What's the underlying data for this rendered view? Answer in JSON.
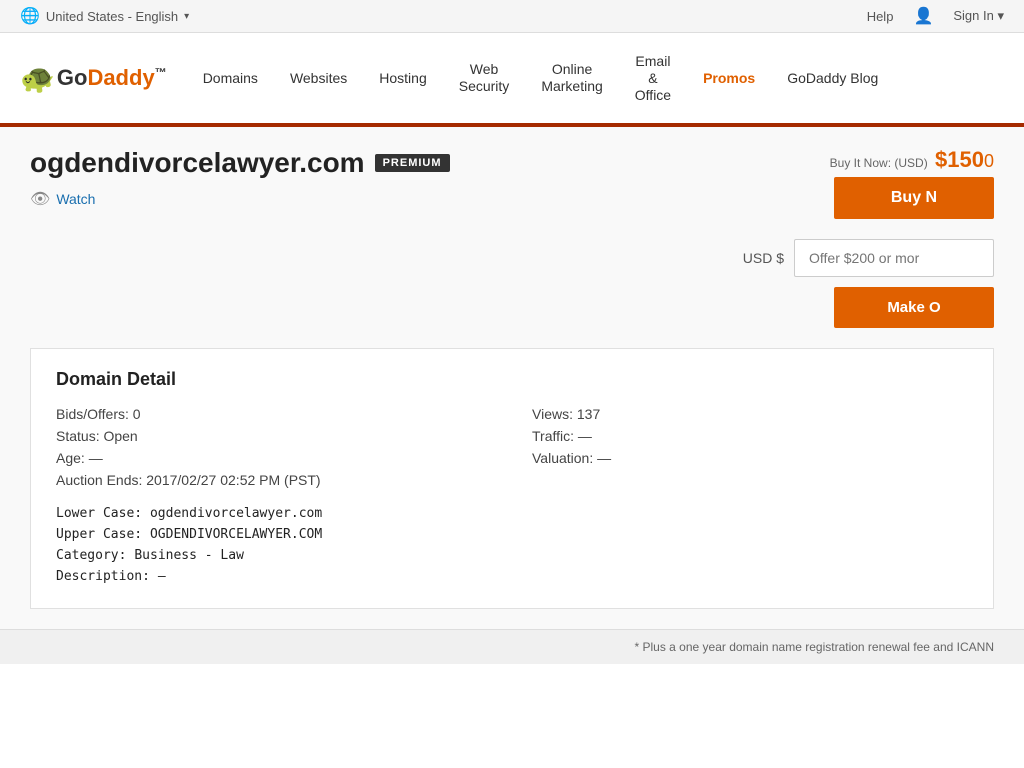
{
  "topbar": {
    "locale": "United States - English",
    "locale_arrow": "▾",
    "help_label": "Help",
    "signin_label": "Sign In",
    "signin_arrow": "▾"
  },
  "nav": {
    "logo": "GoDaddy",
    "trademark": "™",
    "items": [
      {
        "id": "domains",
        "label": "Domains"
      },
      {
        "id": "websites",
        "label": "Websites"
      },
      {
        "id": "hosting",
        "label": "Hosting"
      },
      {
        "id": "web-security",
        "label": "Web\nSecurity"
      },
      {
        "id": "online-marketing",
        "label": "Online\nMarketing"
      },
      {
        "id": "email-office",
        "label": "Email\n&\nOffice"
      },
      {
        "id": "promos",
        "label": "Promos"
      },
      {
        "id": "godaddy-blog",
        "label": "GoDaddy Blog"
      }
    ]
  },
  "domain": {
    "name": "ogdendivorcelawyer.com",
    "badge": "PREMIUM",
    "watch_label": "Watch",
    "price_label": "Buy It Now: (USD)",
    "price": "$150",
    "price_suffix": "0",
    "buy_now_label": "Buy N",
    "usd_label": "USD $",
    "offer_placeholder": "Offer $200 or mor",
    "make_offer_label": "Make O",
    "detail": {
      "heading": "Domain Detail",
      "bids": "Bids/Offers: 0",
      "views": "Views: 137",
      "status": "Status: Open",
      "traffic": "Traffic: —",
      "age": "Age: —",
      "valuation": "Valuation: —",
      "auction_ends": "Auction Ends: 2017/02/27 02:52 PM (PST)",
      "lowercase_label": "Lower Case:",
      "lowercase_value": "ogdendivorcelawyer.com",
      "uppercase_label": "Upper Case:",
      "uppercase_value": "OGDENDIVORCELAWYER.COM",
      "category_label": "Category:",
      "category_value": "Business - Law",
      "description_label": "Description:",
      "description_value": "—"
    }
  },
  "footer": {
    "note": "* Plus a one year domain name registration renewal fee and ICANN"
  }
}
